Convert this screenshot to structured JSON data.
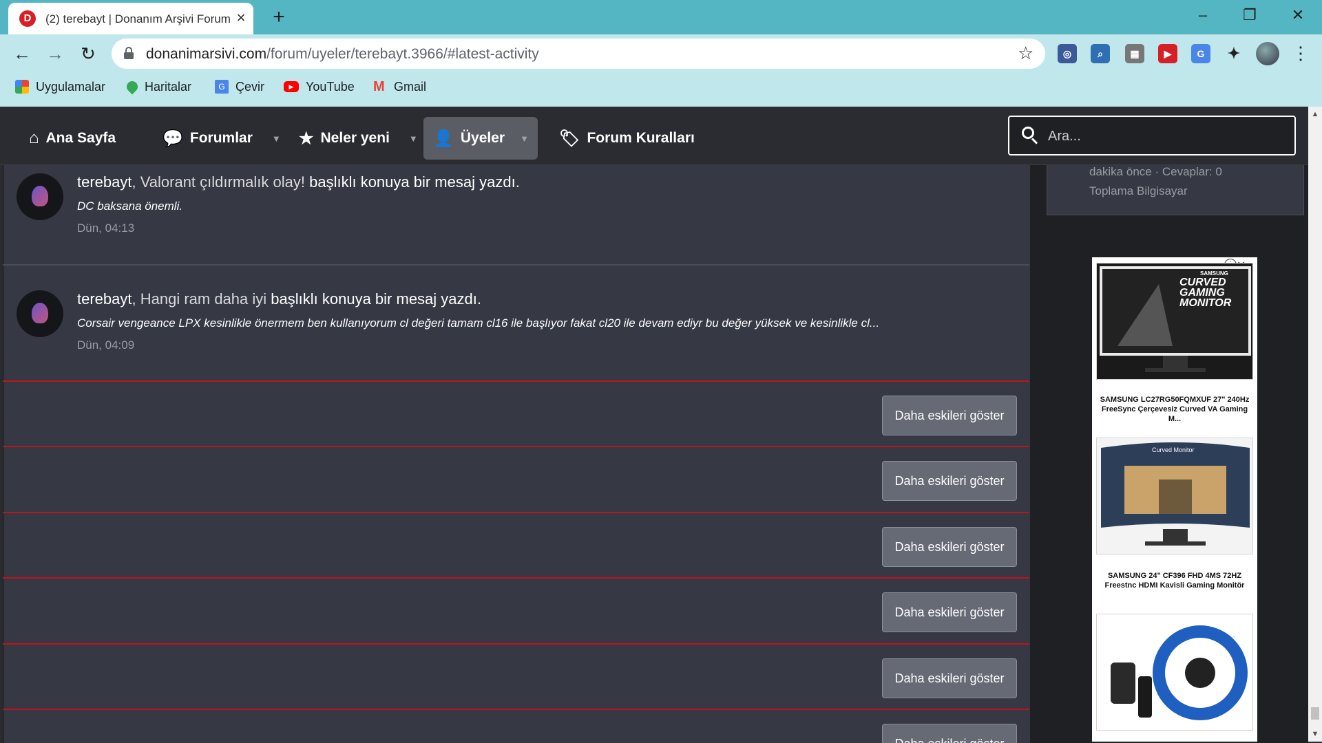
{
  "browser": {
    "tab_title": "(2) terebayt | Donanım Arşivi Forum",
    "tab_favicon_letter": "D",
    "url_host": "donanimarsivi.com",
    "url_path": "/forum/uyeler/terebayt.3966/#latest-activity",
    "bookmarks": [
      {
        "label": "Uygulamalar",
        "icon": "apps-grid-icon"
      },
      {
        "label": "Haritalar",
        "icon": "maps-pin-icon"
      },
      {
        "label": "Çevir",
        "icon": "translate-icon"
      },
      {
        "label": "YouTube",
        "icon": "youtube-icon"
      },
      {
        "label": "Gmail",
        "icon": "gmail-icon"
      }
    ]
  },
  "nav": {
    "home": "Ana Sayfa",
    "forums": "Forumlar",
    "whats_new": "Neler yeni",
    "members": "Üyeler",
    "rules": "Forum Kuralları",
    "search_placeholder": "Ara..."
  },
  "activities": [
    {
      "user": "terebayt",
      "thread": "Valorant çıldırmalık olay!",
      "action": "başlıklı konuya bir mesaj yazdı.",
      "snippet": "DC baksana önemli.",
      "time": "Dün, 04:13"
    },
    {
      "user": "terebayt",
      "thread": "Hangi ram daha iyi",
      "action": "başlıklı konuya bir mesaj yazdı.",
      "snippet": "Corsair vengeance LPX kesinlikle önermem ben kullanıyorum cl değeri tamam cl16 ile başlıyor fakat cl20 ile devam ediyr bu değer yüksek ve kesinlikle cl...",
      "time": "Dün, 04:09"
    }
  ],
  "load_more_label": "Daha eskileri göster",
  "sidebar": {
    "meta_line": "dakika önce · Cevaplar: 0",
    "forum_name": "Toplama Bilgisayar"
  },
  "ad": {
    "items": [
      {
        "caption": "SAMSUNG LC27RG50FQMXUF 27\" 240Hz FreeSync Çerçevesiz Curved VA Gaming M...",
        "image_text": "CURVED GAMING MONITOR",
        "brand": "SAMSUNG"
      },
      {
        "caption": "SAMSUNG 24\" CF396 FHD 4MS 72HZ Freestnc HDMI Kavisli Gaming Monitör",
        "image_text": "Curved Monitor",
        "brand": ""
      },
      {
        "caption": "",
        "image_text": "",
        "brand": ""
      }
    ]
  },
  "colors": {
    "accent_red": "#c0141b",
    "nav_bg": "#2a2c31",
    "content_bg": "#363843",
    "button_bg": "#656a75"
  }
}
